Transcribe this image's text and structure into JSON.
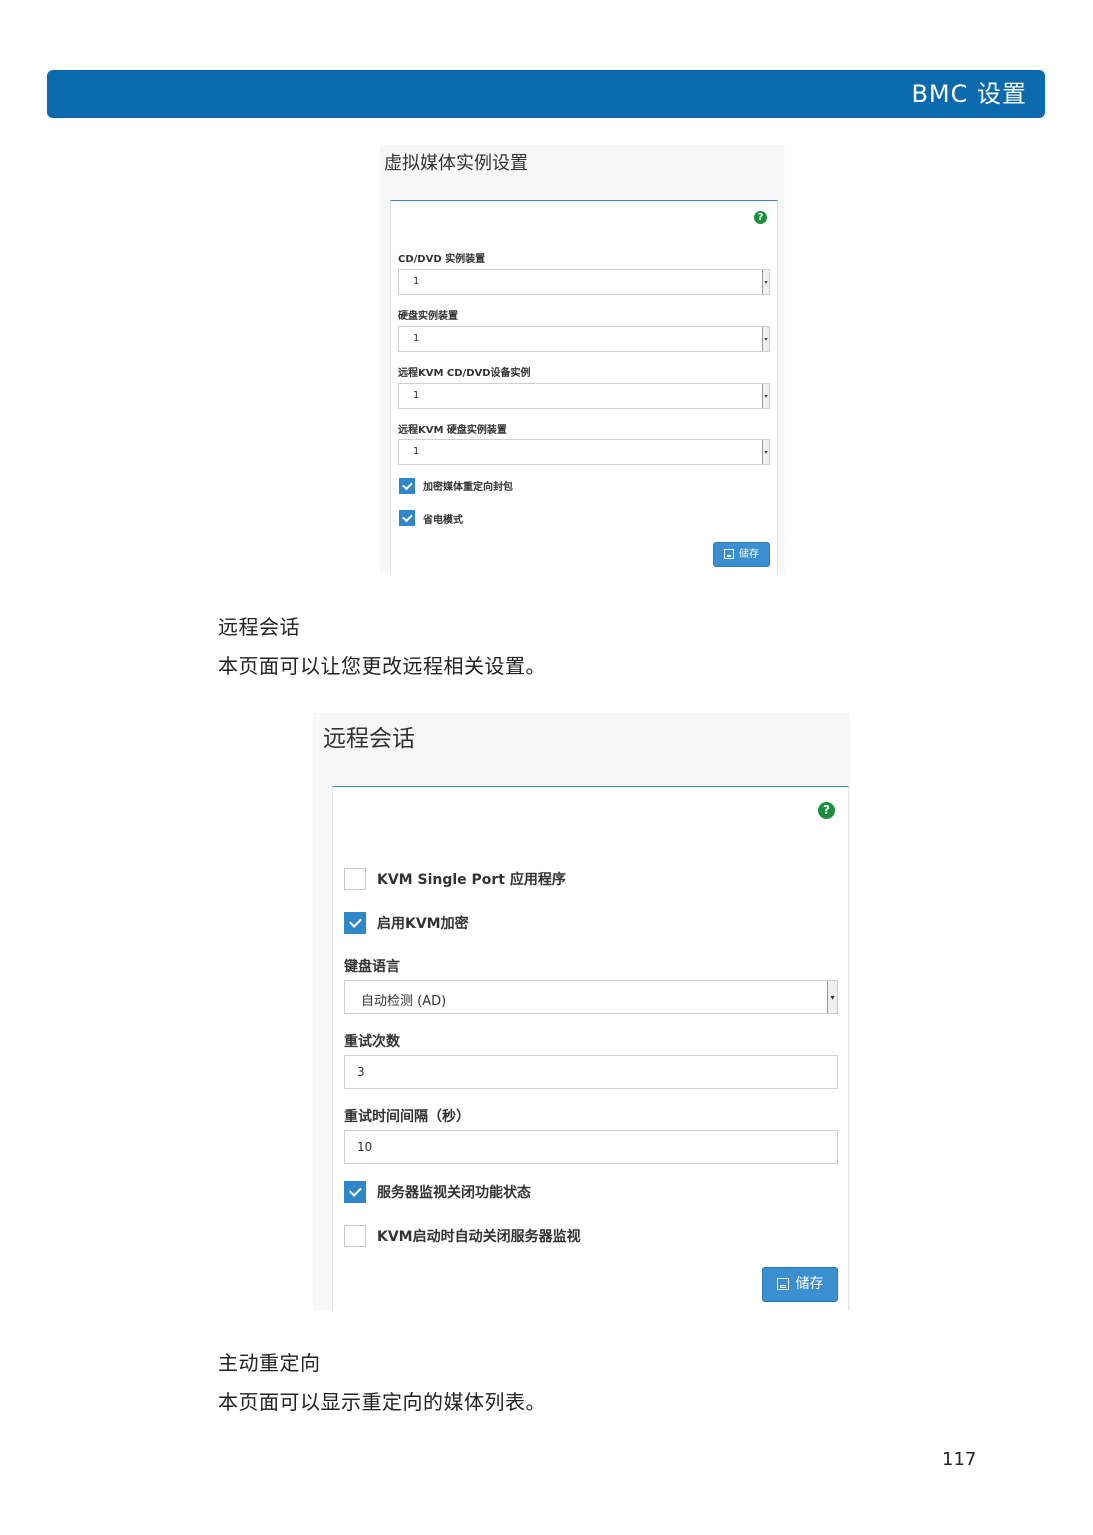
{
  "header": {
    "title": "BMC 设置"
  },
  "virtual_media": {
    "title": "虚拟媒体实例设置",
    "help": "?",
    "fields": [
      {
        "label": "CD/DVD 实例装置",
        "value": "1"
      },
      {
        "label": "硬盘实例装置",
        "value": "1"
      },
      {
        "label": "远程KVM CD/DVD设备实例",
        "value": "1"
      },
      {
        "label": "远程KVM 硬盘实例装置",
        "value": "1"
      }
    ],
    "checkboxes": [
      {
        "label": "加密媒体重定向封包",
        "checked": true
      },
      {
        "label": "省电模式",
        "checked": true
      }
    ],
    "save_label": "储存"
  },
  "section1": {
    "heading": "远程会话",
    "description": "本页面可以让您更改远程相关设置。"
  },
  "remote_session": {
    "title": "远程会话",
    "help": "?",
    "checkbox_kvm_single_port": {
      "label": "KVM Single Port 应用程序",
      "checked": false
    },
    "checkbox_kvm_encrypt": {
      "label": "启用KVM加密",
      "checked": true
    },
    "keyboard_language": {
      "label": "键盘语言",
      "value": "自动检测 (AD)"
    },
    "retry_count": {
      "label": "重试次数",
      "value": "3"
    },
    "retry_interval": {
      "label": "重试时间间隔（秒）",
      "value": "10"
    },
    "checkbox_server_monitor_off": {
      "label": "服务器监视关闭功能状态",
      "checked": true
    },
    "checkbox_kvm_auto_off": {
      "label": "KVM启动时自动关闭服务器监视",
      "checked": false
    },
    "save_label": "储存"
  },
  "section2": {
    "heading": "主动重定向",
    "description": "本页面可以显示重定向的媒体列表。"
  },
  "page_number": "117"
}
